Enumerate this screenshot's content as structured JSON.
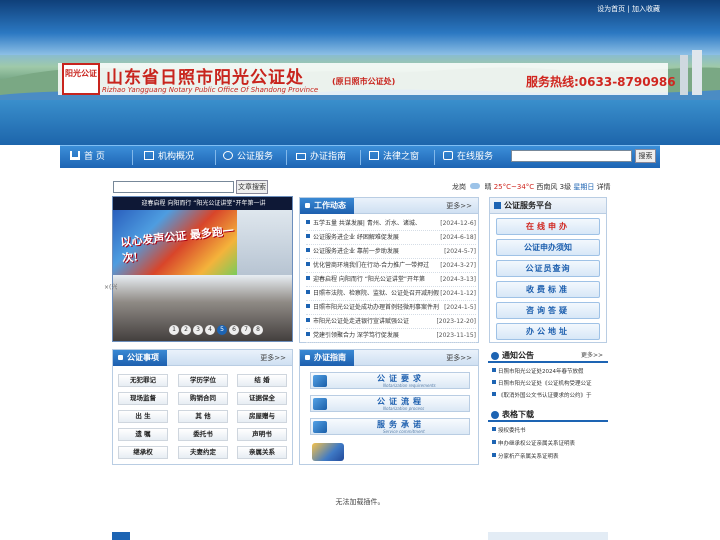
{
  "top_links": {
    "home": "设为首页",
    "sep": " | ",
    "fav": "加入收藏"
  },
  "header": {
    "seal_text": "阳光公证",
    "title": "山东省日照市阳光公证处",
    "title_sub": "(原日照市公证处)",
    "title_en": "Rizhao Yangguang Notary Public Office Of Shandong Province",
    "hotline": "服务热线:0633-8790986"
  },
  "nav": {
    "items": [
      {
        "label": "首  页",
        "icon": "home-icon"
      },
      {
        "label": "机构概况",
        "icon": "building-icon"
      },
      {
        "label": "公证服务",
        "icon": "check-icon"
      },
      {
        "label": "办证指南",
        "icon": "card-icon"
      },
      {
        "label": "法律之窗",
        "icon": "window-icon"
      },
      {
        "label": "在线服务",
        "icon": "online-icon"
      }
    ],
    "search_button": "搜索"
  },
  "subbar": {
    "search_button": "文章搜索",
    "weather": {
      "city": "龙岗",
      "cond": "晴",
      "temp": "25°C~34°C",
      "wind": "西南风 3级",
      "day": "星期日",
      "detail": "详情"
    }
  },
  "slider": {
    "caption": "迎春启程 向阳而行 “阳光公证讲堂”开年第一讲",
    "banner_text": "以心发声公证 最多跑一次!",
    "dots": [
      "1",
      "2",
      "3",
      "4",
      "5",
      "6",
      "7",
      "8"
    ],
    "active_dot": "5",
    "stray": "×(兴"
  },
  "news": {
    "title": "工作动态",
    "more": "更多>>",
    "items": [
      {
        "text": "五学五量 共谋发展| 青州、沂水、诸城、",
        "date": "[2024-12-6]"
      },
      {
        "text": "公证服务进企业 纾困解难促发展",
        "date": "[2024-6-18]"
      },
      {
        "text": "公证服务进企业 靠前一步助发展",
        "date": "[2024-5-7]"
      },
      {
        "text": "优化营商环境我们在行动-合力推广一带押过",
        "date": "[2024-3-27]"
      },
      {
        "text": "迎春启程 向阳而行 “阳光公证讲堂”开年第",
        "date": "[2024-3-13]"
      },
      {
        "text": "日照市法院、检察院、监狱、公证处召开减刑假",
        "date": "[2024-1-12]"
      },
      {
        "text": "日照市阳光公证处成功办理首例轻微刑事案件刑",
        "date": "[2024-1-5]"
      },
      {
        "text": "市阳光公证处走进银行宣讲赋强公证",
        "date": "[2023-12-20]"
      },
      {
        "text": "党建引领聚合力 深学笃行促发展",
        "date": "[2023-11-15]"
      }
    ]
  },
  "platform": {
    "title": "公证服务平台",
    "buttons": [
      "在线申办",
      "公证申办须知",
      "公证员查询",
      "收费标准",
      "咨询答疑",
      "办公地址"
    ]
  },
  "matters": {
    "title": "公证事项",
    "more": "更多>>",
    "items": [
      "无犯罪记",
      "学历学位",
      "结  婚",
      "现场监督",
      "购销合同",
      "证据保全",
      "出  生",
      "其  他",
      "房屋赠与",
      "遗  嘱",
      "委托书",
      "声明书",
      "继承权",
      "夫妻约定",
      "亲属关系"
    ]
  },
  "guide": {
    "title": "办证指南",
    "more": "更多>>",
    "items": [
      {
        "label": "公证要求",
        "en": "Notarization requirements"
      },
      {
        "label": "公证流程",
        "en": "Notarization process"
      },
      {
        "label": "服务承诺",
        "en": "Service commitment"
      }
    ]
  },
  "notice": {
    "title": "通知公告",
    "more": "更多>>",
    "items": [
      "日照市阳光公证处2024年春节放假",
      "日照市阳光公证处《公证机构受理公证",
      "《取消外国公文书认证要求的公约》于"
    ]
  },
  "download": {
    "title": "表格下载",
    "items": [
      "授权委托书",
      "申办继承权公证亲属关系证明表",
      "分家析产亲属关系证明表"
    ]
  },
  "plugin_msg": "无法加载插件。"
}
